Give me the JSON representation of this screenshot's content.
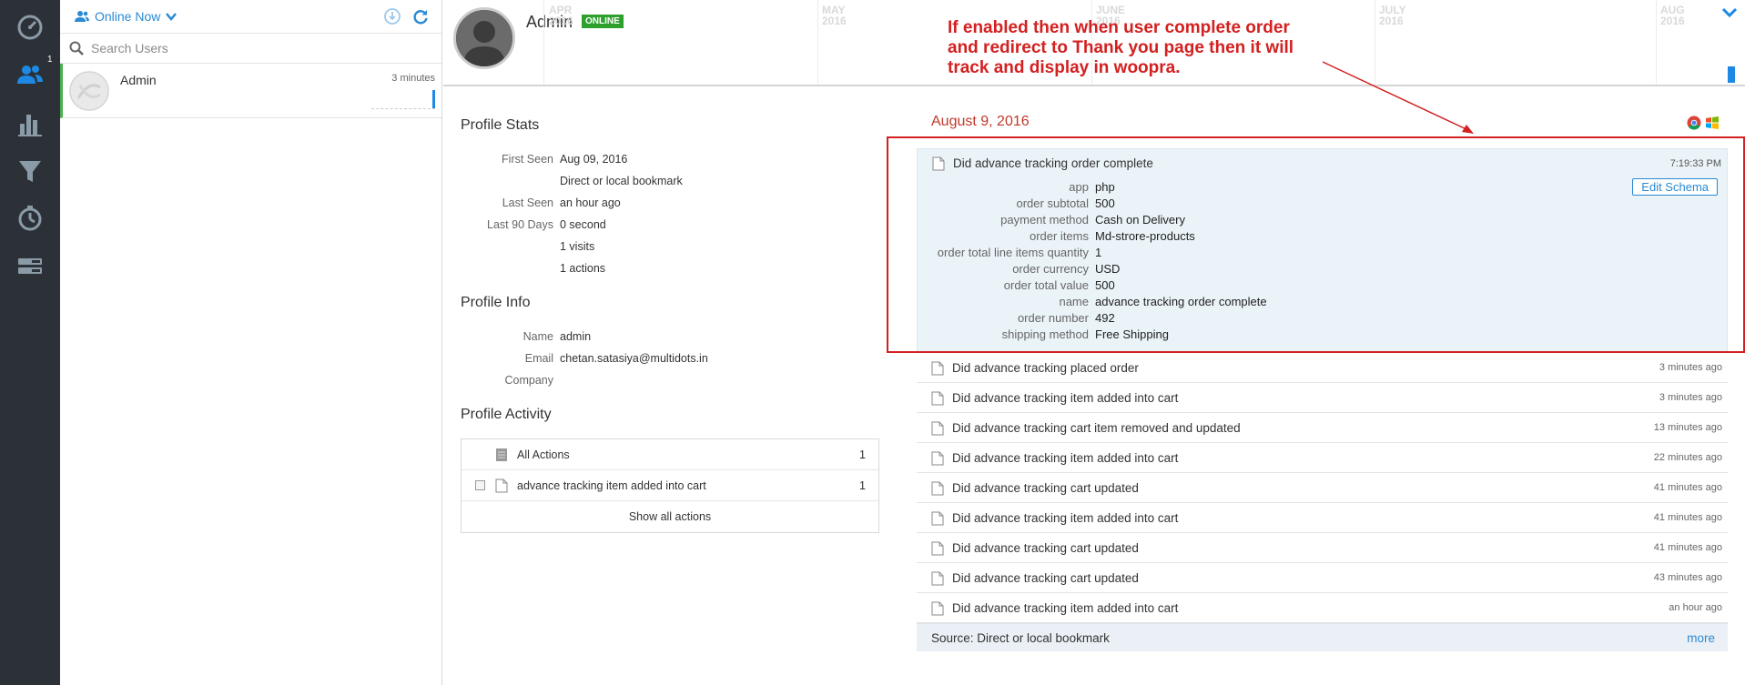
{
  "sidebar": {
    "items": [
      {
        "icon": "dashboard-icon"
      },
      {
        "icon": "users-icon",
        "badge": "1"
      },
      {
        "icon": "reports-icon"
      },
      {
        "icon": "funnel-icon"
      },
      {
        "icon": "retention-icon"
      },
      {
        "icon": "settings-icon"
      }
    ]
  },
  "users_panel": {
    "filter_label": "Online Now",
    "search_placeholder": "Search Users",
    "users": [
      {
        "name": "Admin",
        "time": "3 minutes"
      }
    ]
  },
  "profile": {
    "name": "Admin",
    "status": "ONLINE",
    "timeline_months": [
      {
        "name": "APR",
        "year": "2016"
      },
      {
        "name": "MAY",
        "year": "2016"
      },
      {
        "name": "JUNE",
        "year": "2016"
      },
      {
        "name": "JULY",
        "year": "2016"
      },
      {
        "name": "AUG",
        "year": "2016"
      }
    ]
  },
  "annotation": {
    "lines": [
      "If enabled then when user complete order",
      "and redirect to Thank you page then it will",
      "track and display in woopra."
    ]
  },
  "stats": {
    "title": "Profile Stats",
    "rows": [
      {
        "key": "First Seen",
        "value": "Aug 09, 2016"
      },
      {
        "key": "",
        "value": "Direct or local bookmark"
      },
      {
        "key": "Last Seen",
        "value": "an hour ago"
      },
      {
        "key": "Last 90 Days",
        "value": "0 second"
      },
      {
        "key": "",
        "value": "1 visits"
      },
      {
        "key": "",
        "value": "1 actions"
      }
    ]
  },
  "info": {
    "title": "Profile Info",
    "rows": [
      {
        "key": "Name",
        "value": "admin"
      },
      {
        "key": "Email",
        "value": "chetan.satasiya@multidots.in"
      },
      {
        "key": "Company",
        "value": ""
      }
    ]
  },
  "activity": {
    "title": "Profile Activity",
    "rows": [
      {
        "label": "All Actions",
        "count": "1"
      },
      {
        "label": "advance tracking item added into cart",
        "count": "1"
      }
    ],
    "show_all": "Show all actions"
  },
  "stream": {
    "date": "August 9, 2016",
    "expanded": {
      "title": "Did advance tracking order complete",
      "time": "7:19:33 PM",
      "edit_label": "Edit Schema",
      "props": [
        {
          "key": "app",
          "value": "php"
        },
        {
          "key": "order subtotal",
          "value": "500"
        },
        {
          "key": "payment method",
          "value": "Cash on Delivery"
        },
        {
          "key": "order items",
          "value": "Md-strore-products"
        },
        {
          "key": "order total line items quantity",
          "value": "1"
        },
        {
          "key": "order currency",
          "value": "USD"
        },
        {
          "key": "order total value",
          "value": "500"
        },
        {
          "key": "name",
          "value": "advance tracking order complete"
        },
        {
          "key": "order number",
          "value": "492"
        },
        {
          "key": "shipping method",
          "value": "Free Shipping"
        }
      ]
    },
    "events": [
      {
        "title": "Did advance tracking placed order",
        "time": "3 minutes ago"
      },
      {
        "title": "Did advance tracking item added into cart",
        "time": "3 minutes ago"
      },
      {
        "title": "Did advance tracking cart item removed and updated",
        "time": "13 minutes ago"
      },
      {
        "title": "Did advance tracking item added into cart",
        "time": "22 minutes ago"
      },
      {
        "title": "Did advance tracking cart updated",
        "time": "41 minutes ago"
      },
      {
        "title": "Did advance tracking item added into cart",
        "time": "41 minutes ago"
      },
      {
        "title": "Did advance tracking cart updated",
        "time": "41 minutes ago"
      },
      {
        "title": "Did advance tracking cart updated",
        "time": "43 minutes ago"
      },
      {
        "title": "Did advance tracking item added into cart",
        "time": "an hour ago"
      }
    ],
    "source": "Source: Direct or local bookmark",
    "more": "more"
  },
  "colors": {
    "accent": "#2a8ad4",
    "annotation": "#d32020",
    "online": "#2ea02e",
    "rail": "#2b3136"
  }
}
